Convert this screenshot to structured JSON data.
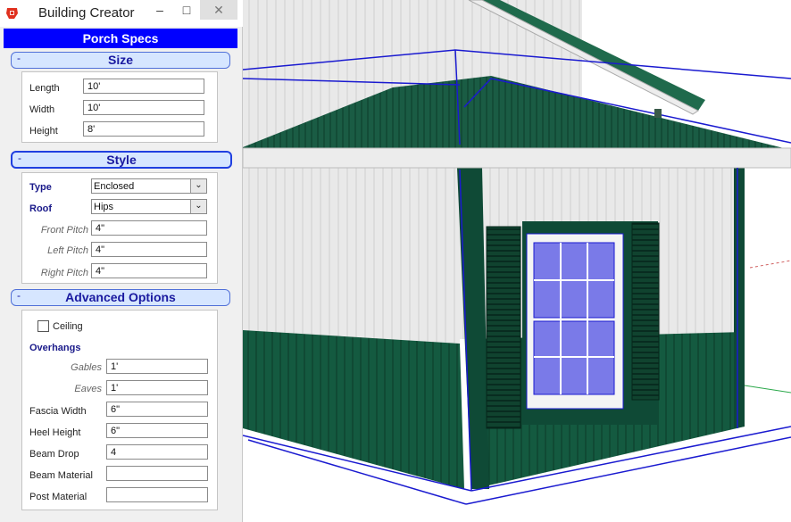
{
  "window": {
    "title": "Building Creator",
    "minimize": "–",
    "maximize": "□",
    "close": "✕"
  },
  "header": {
    "title": "Porch Specs"
  },
  "sections": {
    "size": {
      "title": "Size",
      "toggle": "-"
    },
    "style": {
      "title": "Style",
      "toggle": "-"
    },
    "advanced": {
      "title": "Advanced Options",
      "toggle": "-"
    }
  },
  "size": {
    "length_label": "Length",
    "length": "10'",
    "width_label": "Width",
    "width": "10'",
    "height_label": "Height",
    "height": "8'"
  },
  "style": {
    "type_label": "Type",
    "type": "Enclosed",
    "roof_label": "Roof",
    "roof": "Hips",
    "front_pitch_label": "Front Pitch",
    "front_pitch": "4\"",
    "left_pitch_label": "Left Pitch",
    "left_pitch": "4\"",
    "right_pitch_label": "Right Pitch",
    "right_pitch": "4\""
  },
  "advanced": {
    "ceiling_label": "Ceiling",
    "ceiling_checked": false,
    "overhangs_label": "Overhangs",
    "gables_label": "Gables",
    "gables": "1'",
    "eaves_label": "Eaves",
    "eaves": "1'",
    "fascia_width_label": "Fascia Width",
    "fascia_width": "6\"",
    "heel_height_label": "Heel Height",
    "heel_height": "6\"",
    "beam_drop_label": "Beam Drop",
    "beam_drop": "4",
    "beam_material_label": "Beam Material",
    "beam_material": "",
    "post_material_label": "Post Material",
    "post_material": ""
  },
  "colors": {
    "accent_blue": "#0000ff",
    "trim_green": "#0f4a36",
    "wall_white": "#e6e6e6",
    "selection_blue": "#1a1ad0"
  }
}
